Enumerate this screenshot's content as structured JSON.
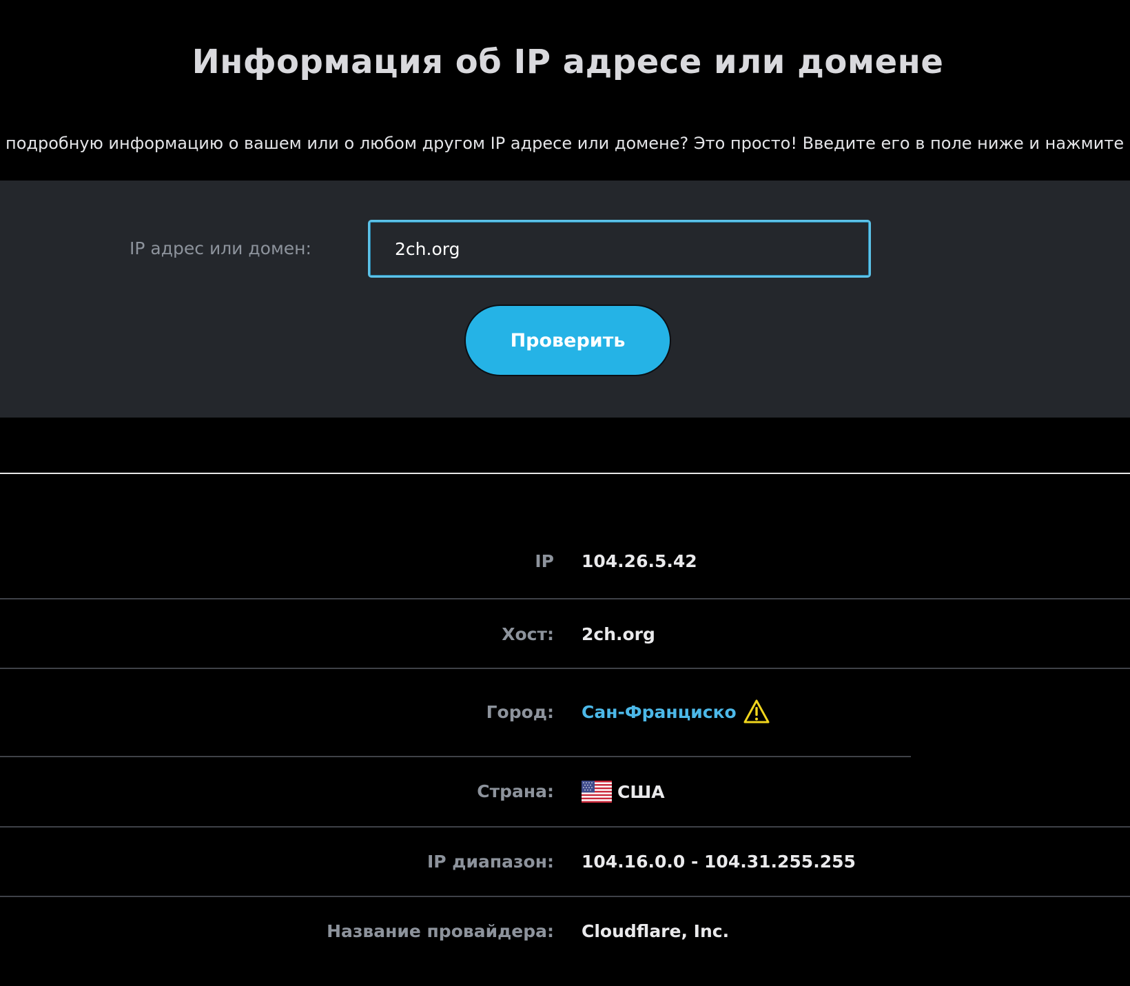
{
  "header": {
    "title": "Информация об IP адресе или домене",
    "intro": "подробную информацию о вашем или о любом другом IP адресе или домене? Это просто! Введите его в поле ниже и нажмите \"Пр"
  },
  "search": {
    "label": "IP адрес или домен:",
    "value": "2ch.org",
    "button_label": "Проверить"
  },
  "info": {
    "ip_label": "IP",
    "ip_value": "104.26.5.42",
    "host_label": "Хост:",
    "host_value": "2ch.org",
    "city_label": "Город:",
    "city_value": "Сан-Франциско",
    "country_label": "Страна:",
    "country_value": "США",
    "range_label": "IP диапазон:",
    "range_value": "104.16.0.0 - 104.31.255.255",
    "provider_label": "Название провайдера:",
    "provider_value": "Cloudflare, Inc."
  },
  "icons": {
    "city_warning": "warning-icon",
    "country_flag": "us-flag-icon"
  },
  "colors": {
    "accent": "#25b3e6",
    "link": "#4cb8e8",
    "warning": "#f1d61d",
    "panel": "#24272c",
    "background": "#000000"
  }
}
